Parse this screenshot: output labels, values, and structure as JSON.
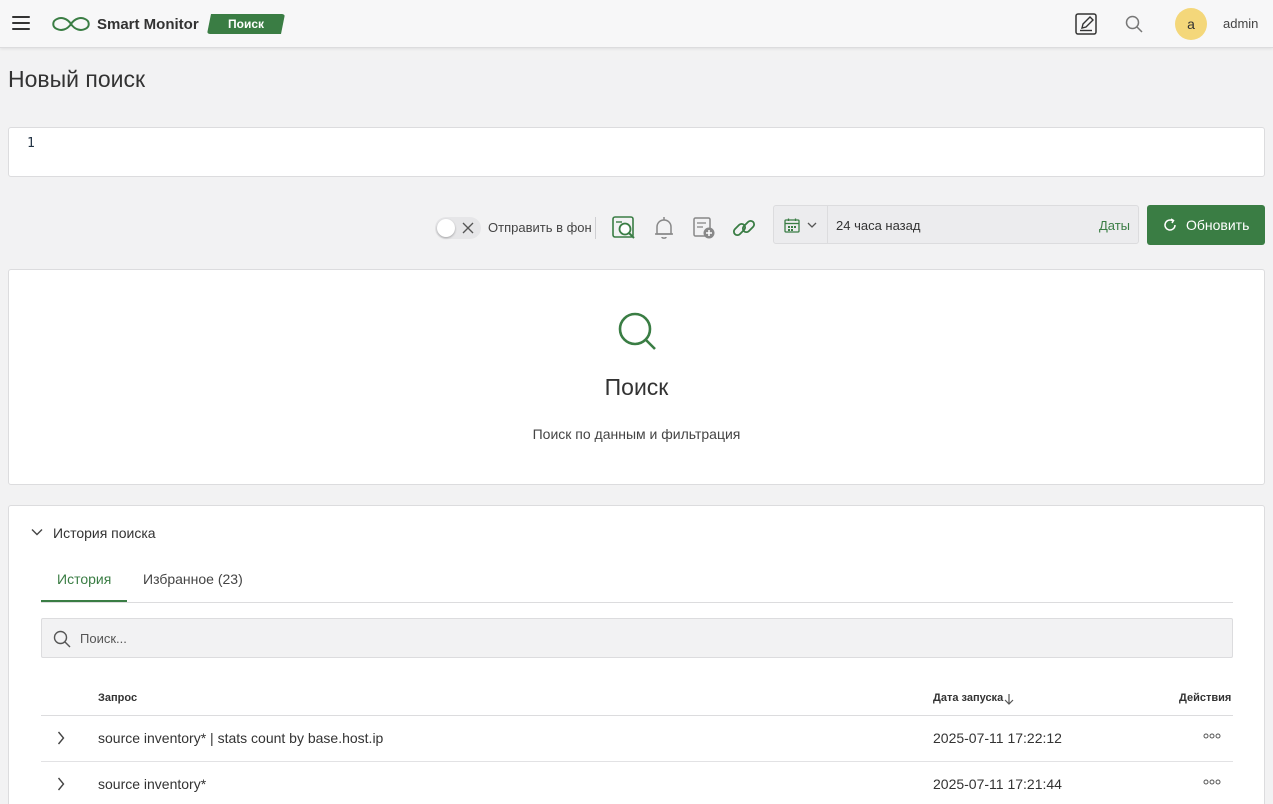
{
  "header": {
    "app_name": "Smart Monitor",
    "section_badge": "Поиск",
    "user_initial": "a",
    "username": "admin",
    "icons": [
      "menu-icon",
      "logo-infinity-icon",
      "edit-icon",
      "search-icon"
    ]
  },
  "page": {
    "title": "Новый поиск"
  },
  "editor": {
    "line_number": "1",
    "query": ""
  },
  "toolbar": {
    "background_toggle_label": "Отправить в фон",
    "background_toggle_on": false,
    "icons": [
      "search-report-icon",
      "bell-icon",
      "add-to-dashboard-icon",
      "link-icon"
    ],
    "time_range": "24 часа назад",
    "dates_link": "Даты",
    "refresh_label": "Обновить"
  },
  "results": {
    "title": "Поиск",
    "subtitle": "Поиск по данным и фильтрация"
  },
  "history": {
    "title": "История поиска",
    "tabs": [
      {
        "label": "История",
        "active": true
      },
      {
        "label": "Избранное (23)",
        "active": false
      }
    ],
    "search_placeholder": "Поиск...",
    "columns": {
      "query": "Запрос",
      "date": "Дата запуска",
      "actions": "Действия"
    },
    "rows": [
      {
        "query": "source inventory* | stats count by base.host.ip",
        "date": "2025-07-11 17:22:12"
      },
      {
        "query": "source inventory*",
        "date": "2025-07-11 17:21:44"
      }
    ]
  },
  "colors": {
    "accent": "#3a7d44",
    "avatar": "#f4d77a",
    "background": "#f2f2f3"
  }
}
